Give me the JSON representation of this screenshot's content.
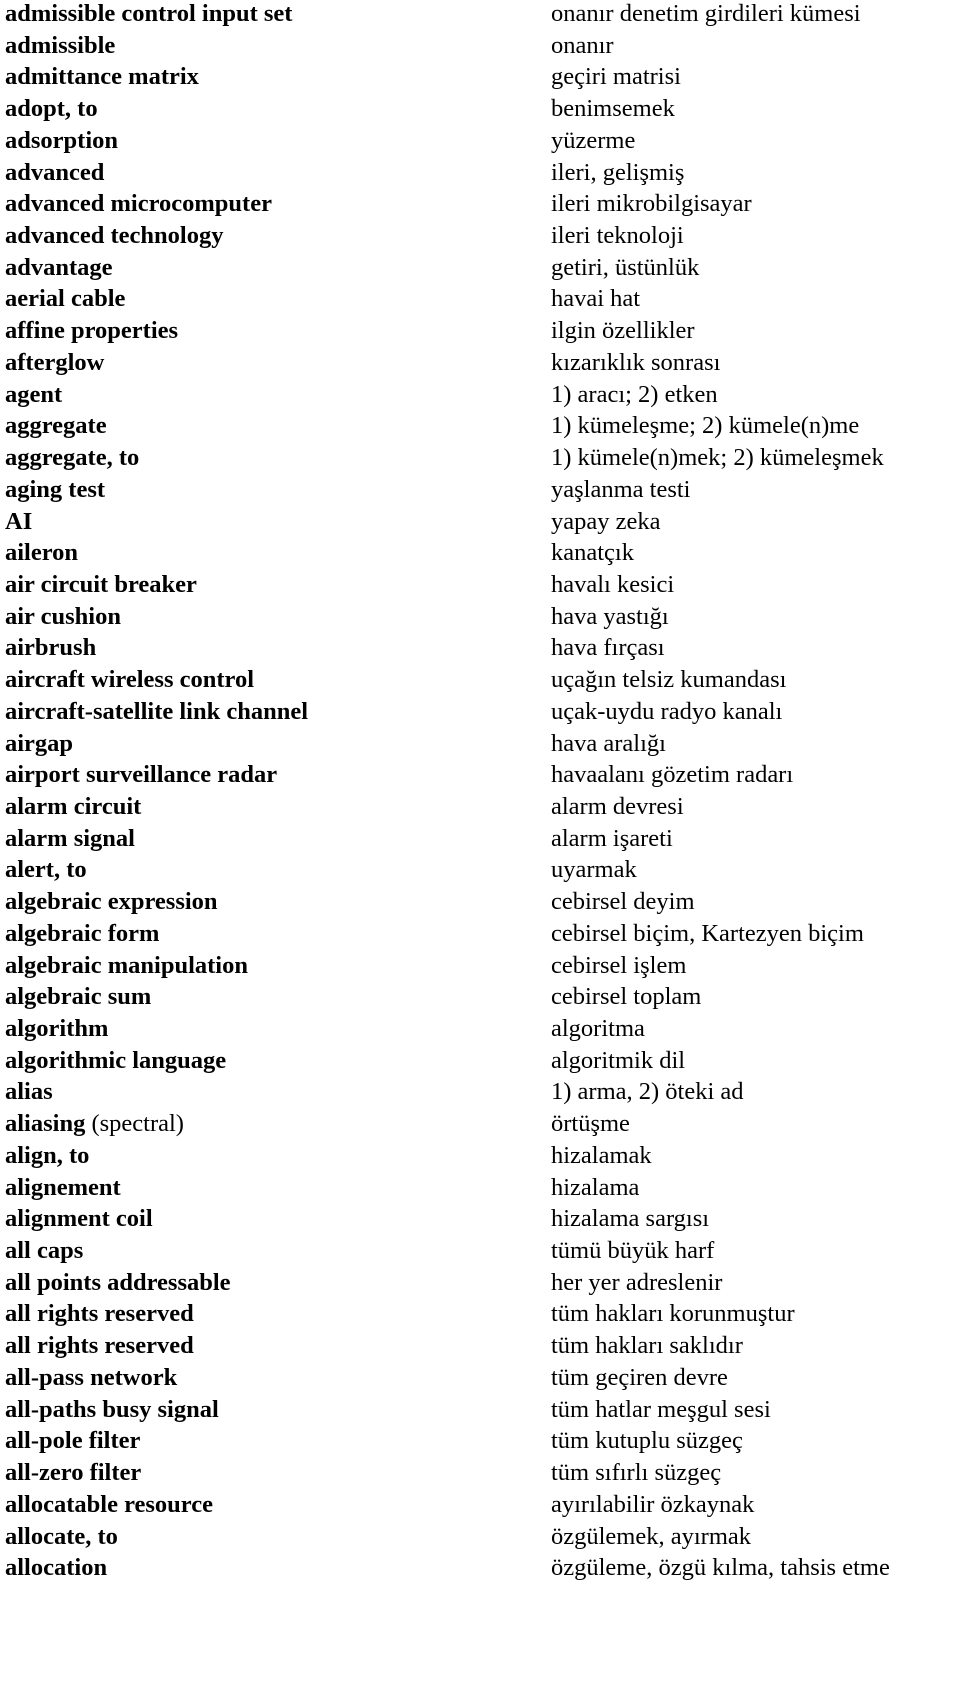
{
  "entries": [
    {
      "term": "admissible control input set",
      "note": "",
      "translation": "onanır denetim girdileri kümesi"
    },
    {
      "term": "admissible",
      "note": "",
      "translation": "onanır"
    },
    {
      "term": "admittance matrix",
      "note": "",
      "translation": "geçiri matrisi"
    },
    {
      "term": "adopt, to",
      "note": "",
      "translation": "benimsemek"
    },
    {
      "term": "adsorption",
      "note": "",
      "translation": "yüzerme"
    },
    {
      "term": "advanced",
      "note": "",
      "translation": "ileri, gelişmiş"
    },
    {
      "term": "advanced microcomputer",
      "note": "",
      "translation": "ileri mikrobilgisayar"
    },
    {
      "term": "advanced technology",
      "note": "",
      "translation": "ileri teknoloji"
    },
    {
      "term": "advantage",
      "note": "",
      "translation": "getiri, üstünlük"
    },
    {
      "term": "aerial cable",
      "note": "",
      "translation": "havai hat"
    },
    {
      "term": "affine properties",
      "note": "",
      "translation": "ilgin özellikler"
    },
    {
      "term": "afterglow",
      "note": "",
      "translation": "kızarıklık sonrası"
    },
    {
      "term": "agent",
      "note": "",
      "translation": "1) aracı; 2) etken"
    },
    {
      "term": "aggregate",
      "note": "",
      "translation": "1) kümeleşme; 2) kümele(n)me"
    },
    {
      "term": "aggregate, to",
      "note": "",
      "translation": "1) kümele(n)mek; 2) kümeleşmek"
    },
    {
      "term": "aging test",
      "note": "",
      "translation": "yaşlanma testi"
    },
    {
      "term": "AI",
      "note": "",
      "translation": "yapay zeka"
    },
    {
      "term": "aileron",
      "note": "",
      "translation": "kanatçık"
    },
    {
      "term": "air circuit breaker",
      "note": "",
      "translation": "havalı kesici"
    },
    {
      "term": "air cushion",
      "note": "",
      "translation": "hava yastığı"
    },
    {
      "term": "airbrush",
      "note": "",
      "translation": "hava fırçası"
    },
    {
      "term": "aircraft wireless control",
      "note": "",
      "translation": "uçağın telsiz kumandası"
    },
    {
      "term": "aircraft-satellite link channel",
      "note": "",
      "translation": "uçak-uydu radyo kanalı"
    },
    {
      "term": "airgap",
      "note": "",
      "translation": "hava aralığı"
    },
    {
      "term": "airport surveillance radar",
      "note": "",
      "translation": "havaalanı gözetim radarı"
    },
    {
      "term": "alarm circuit",
      "note": "",
      "translation": "alarm devresi"
    },
    {
      "term": "alarm signal",
      "note": "",
      "translation": "alarm işareti"
    },
    {
      "term": "alert, to",
      "note": "",
      "translation": "uyarmak"
    },
    {
      "term": "algebraic expression",
      "note": "",
      "translation": "cebirsel deyim"
    },
    {
      "term": "algebraic form",
      "note": "",
      "translation": "cebirsel biçim, Kartezyen biçim"
    },
    {
      "term": "algebraic manipulation",
      "note": "",
      "translation": "cebirsel işlem"
    },
    {
      "term": "algebraic sum",
      "note": "",
      "translation": "cebirsel toplam"
    },
    {
      "term": "algorithm",
      "note": "",
      "translation": "algoritma"
    },
    {
      "term": "algorithmic language",
      "note": "",
      "translation": "algoritmik dil"
    },
    {
      "term": "alias",
      "note": "",
      "translation": "1) arma, 2) öteki ad"
    },
    {
      "term": "aliasing",
      "note": " (spectral)",
      "translation": "örtüşme"
    },
    {
      "term": "align, to",
      "note": "",
      "translation": "hizalamak"
    },
    {
      "term": "alignement",
      "note": "",
      "translation": "hizalama"
    },
    {
      "term": "alignment coil",
      "note": "",
      "translation": "hizalama sargısı"
    },
    {
      "term": "all caps",
      "note": "",
      "translation": "tümü büyük harf"
    },
    {
      "term": "all points addressable",
      "note": "",
      "translation": "her yer adreslenir"
    },
    {
      "term": "all rights reserved",
      "note": "",
      "translation": "tüm hakları korunmuştur"
    },
    {
      "term": "all rights reserved",
      "note": "",
      "translation": "tüm hakları saklıdır"
    },
    {
      "term": "all-pass network",
      "note": "",
      "translation": "tüm geçiren devre"
    },
    {
      "term": "all-paths busy signal",
      "note": "",
      "translation": "tüm hatlar meşgul sesi"
    },
    {
      "term": "all-pole filter",
      "note": "",
      "translation": "tüm kutuplu süzgeç"
    },
    {
      "term": "all-zero filter",
      "note": "",
      "translation": "tüm sıfırlı süzgeç"
    },
    {
      "term": "allocatable resource",
      "note": "",
      "translation": "ayırılabilir özkaynak"
    },
    {
      "term": "allocate, to",
      "note": "",
      "translation": "özgülemek, ayırmak"
    },
    {
      "term": "allocation",
      "note": "",
      "translation": "özgüleme, özgü kılma, tahsis etme"
    }
  ]
}
